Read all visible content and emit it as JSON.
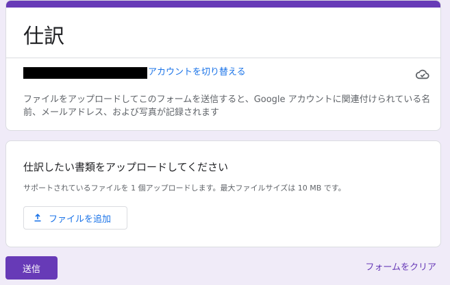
{
  "form": {
    "title": "仕訳",
    "account": {
      "switch_label": "アカウントを切り替える",
      "cloud_icon": "cloud-check-icon",
      "notice": "ファイルをアップロードしてこのフォームを送信すると、Google アカウントに関連付けられている名前、メールアドレス、および写真が記録されます"
    }
  },
  "question": {
    "title": "仕訳したい書類をアップロードしてください",
    "description": "サポートされているファイルを 1 個アップロードします。最大ファイルサイズは 10 MB です。",
    "add_file_label": "ファイルを追加",
    "add_file_icon": "upload-icon"
  },
  "actions": {
    "submit_label": "送信",
    "clear_label": "フォームをクリア"
  },
  "colors": {
    "accent": "#673ab7",
    "link": "#1a73e8",
    "background": "#f0ebf8"
  }
}
